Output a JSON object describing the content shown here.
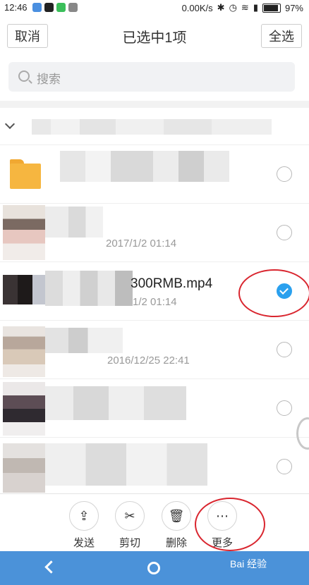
{
  "status_bar": {
    "time": "12:46",
    "net_speed": "0.00K/s",
    "battery": "97%"
  },
  "header": {
    "cancel_label": "取消",
    "title": "已选中1项",
    "select_all_label": "全选"
  },
  "search": {
    "placeholder": "搜索"
  },
  "files": [
    {
      "type": "folder",
      "name": "",
      "meta": "",
      "selected": false
    },
    {
      "type": "video",
      "name": "",
      "meta": "2017/1/2 01:14",
      "selected": false
    },
    {
      "type": "video",
      "name": "300RMB.mp4",
      "meta": "1/2 01:14",
      "selected": true
    },
    {
      "type": "video",
      "name": "",
      "meta": "2016/12/25 22:41",
      "selected": false
    },
    {
      "type": "video",
      "name": "",
      "meta": "",
      "selected": false
    },
    {
      "type": "video",
      "name": "",
      "meta": "",
      "selected": false
    }
  ],
  "actions": [
    {
      "label": "发送",
      "icon": "share-icon"
    },
    {
      "label": "剪切",
      "icon": "scissors-icon"
    },
    {
      "label": "删除",
      "icon": "trash-icon"
    },
    {
      "label": "更多",
      "icon": "more-icon"
    }
  ],
  "watermark": "Bai 经验"
}
